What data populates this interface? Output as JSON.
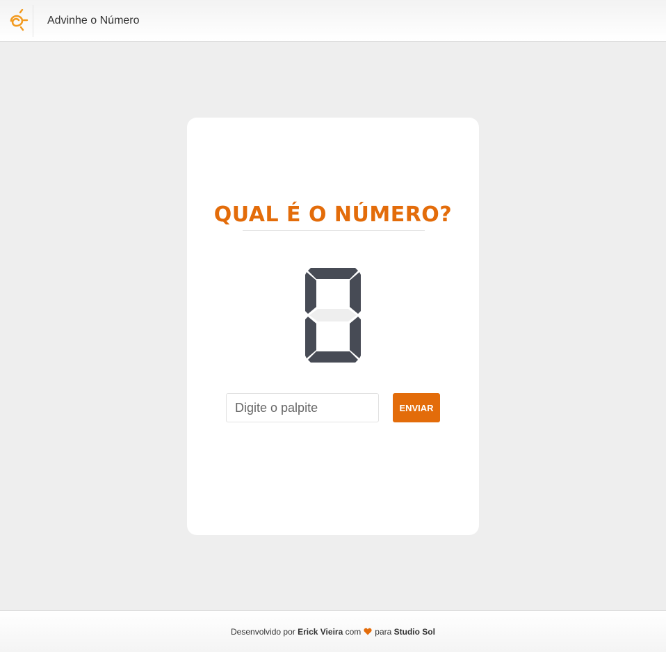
{
  "header": {
    "logo_icon": "studio-sol-sun-icon",
    "title": "Advinhe o Número"
  },
  "game": {
    "question": "QUAL É O NÚMERO?",
    "display_digit": "0",
    "input_placeholder": "Digite o palpite",
    "input_value": "",
    "submit_label": "ENVIAR"
  },
  "footer": {
    "prefix": "Desenvolvido por",
    "author": "Erick Vieira",
    "middle": "com",
    "heart_icon": "heart-icon",
    "for": "para",
    "company": "Studio Sol"
  },
  "colors": {
    "accent": "#e36c0a",
    "segment_on": "#474b55",
    "segment_off": "#eeeeee",
    "background": "#eeeeee"
  }
}
